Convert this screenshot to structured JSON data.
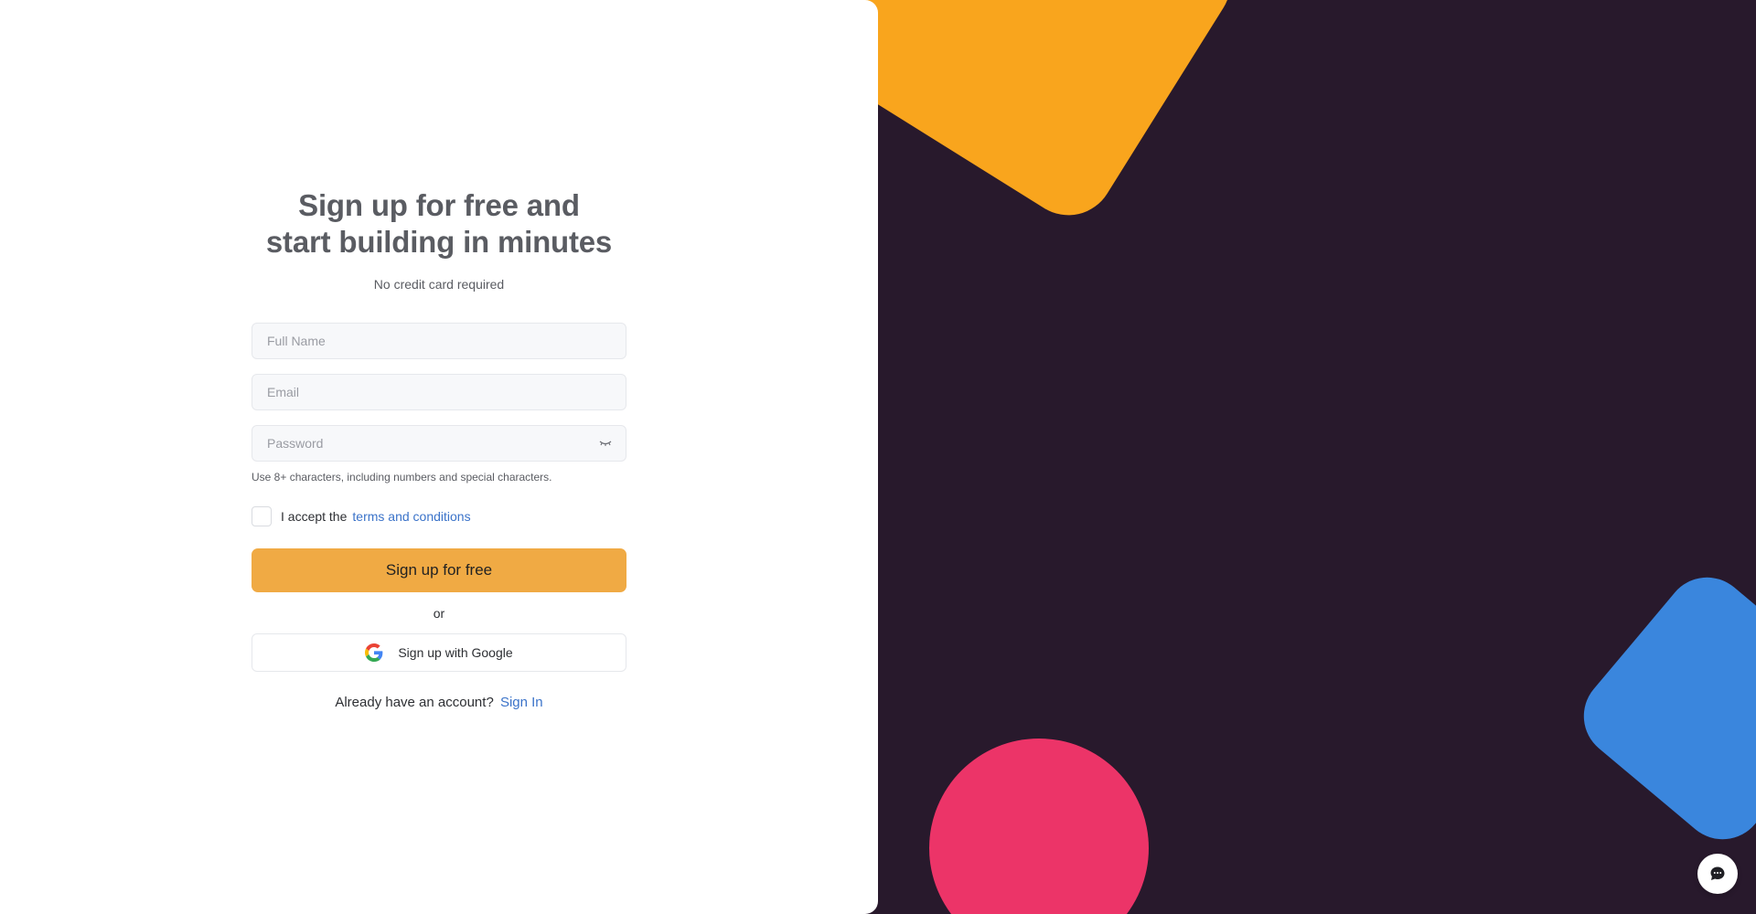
{
  "signup": {
    "headline_line1": "Sign up for free and",
    "headline_line2": "start building in minutes",
    "subline": "No credit card required",
    "full_name_placeholder": "Full Name",
    "email_placeholder": "Email",
    "password_placeholder": "Password",
    "password_hint": "Use 8+ characters, including numbers and special characters.",
    "terms_prefix": "I accept the",
    "terms_link": "terms and conditions",
    "submit_label": "Sign up for free",
    "or_label": "or",
    "google_label": "Sign up with Google",
    "have_account_text": "Already have an account?",
    "signin_link": "Sign In"
  },
  "icons": {
    "password_toggle": "eye-closed-icon",
    "google": "google-icon",
    "chat": "chat-bubble-icon"
  },
  "colors": {
    "primary_button": "#f0aa44",
    "link": "#3b73c9",
    "right_background": "#28192c",
    "shape_orange": "#f9a51d",
    "shape_pink": "#ec3468",
    "shape_blue": "#3a86dd"
  }
}
